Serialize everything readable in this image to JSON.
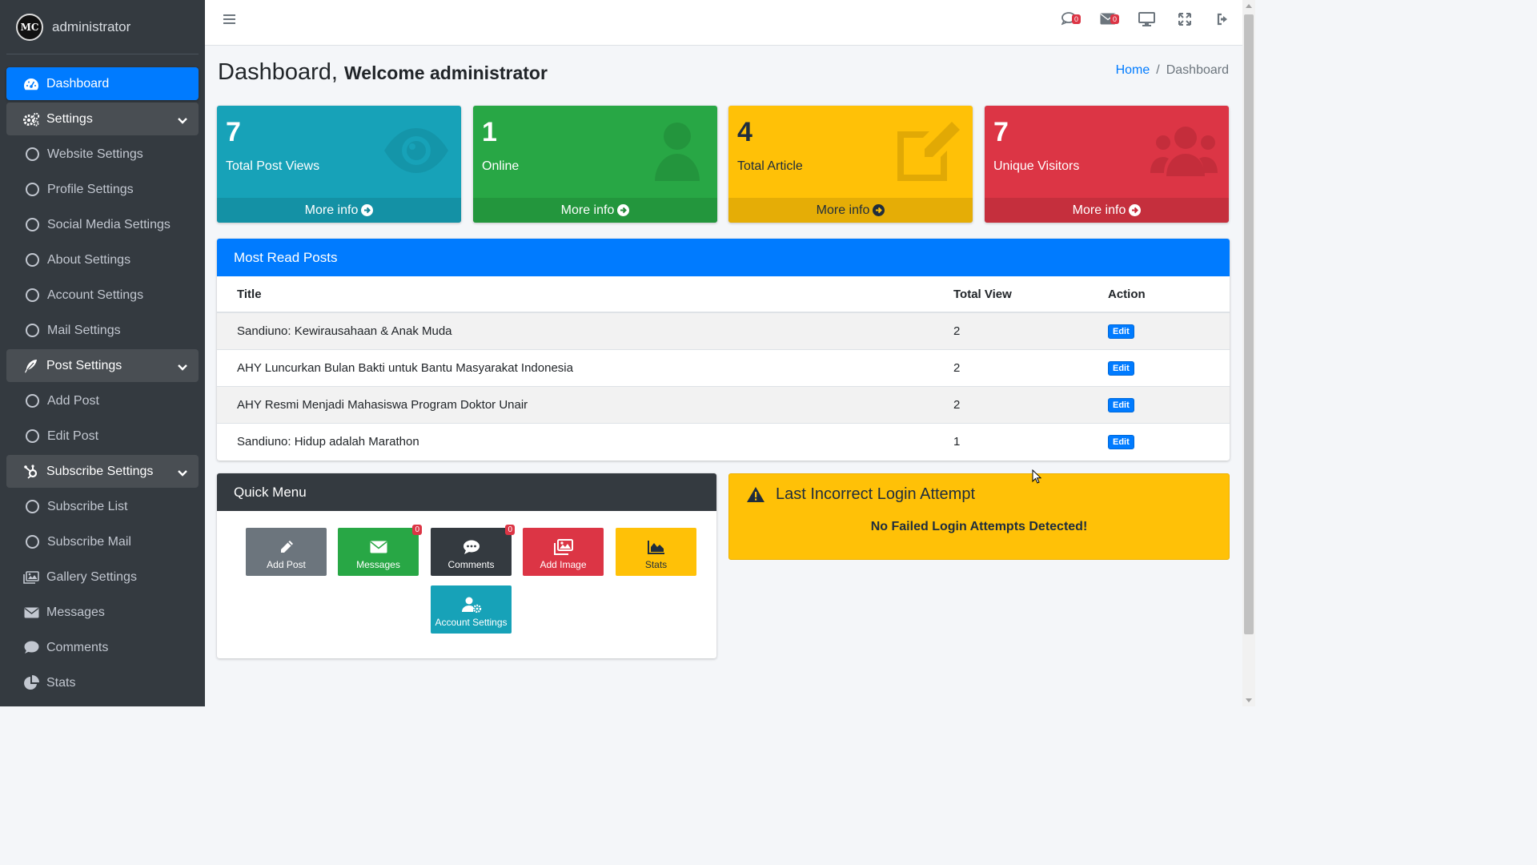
{
  "sidebar": {
    "brand_logo_text": "MC",
    "user_name": "administrator",
    "items": [
      {
        "label": "Dashboard",
        "icon": "dashboard-icon"
      },
      {
        "label": "Settings",
        "icon": "cogs-icon"
      },
      {
        "label": "Website Settings",
        "icon": "circle-icon"
      },
      {
        "label": "Profile Settings",
        "icon": "circle-icon"
      },
      {
        "label": "Social Media Settings",
        "icon": "circle-icon"
      },
      {
        "label": "About Settings",
        "icon": "circle-icon"
      },
      {
        "label": "Account Settings",
        "icon": "circle-icon"
      },
      {
        "label": "Mail Settings",
        "icon": "circle-icon"
      },
      {
        "label": "Post Settings",
        "icon": "feather-icon"
      },
      {
        "label": "Add Post",
        "icon": "circle-icon"
      },
      {
        "label": "Edit Post",
        "icon": "circle-icon"
      },
      {
        "label": "Subscribe Settings",
        "icon": "hubspot-icon"
      },
      {
        "label": "Subscribe List",
        "icon": "circle-icon"
      },
      {
        "label": "Subscribe Mail",
        "icon": "circle-icon"
      },
      {
        "label": "Gallery Settings",
        "icon": "images-icon"
      },
      {
        "label": "Messages",
        "icon": "envelope-icon"
      },
      {
        "label": "Comments",
        "icon": "comment-icon"
      },
      {
        "label": "Stats",
        "icon": "pie-chart-icon"
      }
    ]
  },
  "topbar": {
    "comments_badge": "0",
    "messages_badge": "0"
  },
  "header": {
    "title": "Dashboard,",
    "subtitle": "Welcome administrator",
    "breadcrumb_home": "Home",
    "breadcrumb_sep": "/",
    "breadcrumb_current": "Dashboard"
  },
  "stats": [
    {
      "value": "7",
      "label": "Total Post Views",
      "footer": "More info",
      "icon": "eye-icon",
      "color": "#17a2b8"
    },
    {
      "value": "1",
      "label": "Online",
      "footer": "More info",
      "icon": "user-icon",
      "color": "#28a745"
    },
    {
      "value": "4",
      "label": "Total Article",
      "footer": "More info",
      "icon": "edit-icon",
      "color": "#ffc107"
    },
    {
      "value": "7",
      "label": "Unique Visitors",
      "footer": "More info",
      "icon": "users-icon",
      "color": "#dc3545"
    }
  ],
  "most_read": {
    "title": "Most Read Posts",
    "columns": [
      "Title",
      "Total View",
      "Action"
    ],
    "rows": [
      {
        "title": "Sandiuno: Kewirausahaan & Anak Muda",
        "views": "2",
        "action": "Edit"
      },
      {
        "title": "AHY Luncurkan Bulan Bakti untuk Bantu Masyarakat Indonesia",
        "views": "2",
        "action": "Edit"
      },
      {
        "title": "AHY Resmi Menjadi Mahasiswa Program Doktor Unair",
        "views": "2",
        "action": "Edit"
      },
      {
        "title": "Sandiuno: Hidup adalah Marathon",
        "views": "1",
        "action": "Edit"
      }
    ]
  },
  "quick_menu": {
    "title": "Quick Menu",
    "buttons": [
      {
        "label": "Add Post",
        "icon": "pencil-icon",
        "color": "#6c757d"
      },
      {
        "label": "Messages",
        "icon": "envelope-icon",
        "color": "#28a745",
        "badge": "0"
      },
      {
        "label": "Comments",
        "icon": "comment-dots-icon",
        "color": "#343a40",
        "badge": "0"
      },
      {
        "label": "Add Image",
        "icon": "images-icon",
        "color": "#dc3545"
      },
      {
        "label": "Stats",
        "icon": "area-chart-icon",
        "color": "#ffc107"
      },
      {
        "label": "Account Settings",
        "icon": "user-cog-icon",
        "color": "#17a2b8"
      }
    ]
  },
  "alert": {
    "title": "Last Incorrect Login Attempt",
    "message": "No Failed Login Attempts Detected!"
  }
}
